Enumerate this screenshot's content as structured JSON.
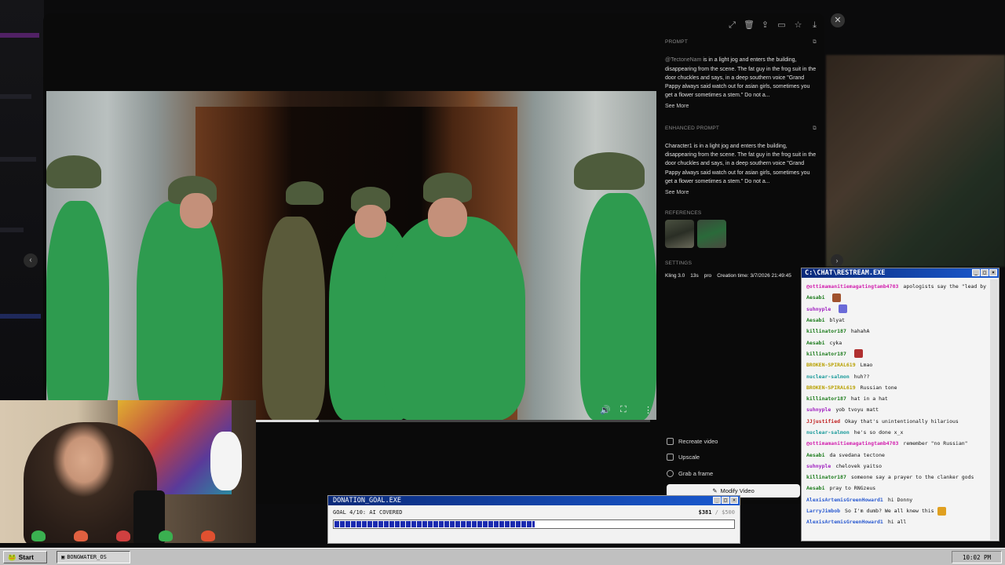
{
  "modal": {
    "toolbar_icons": [
      "expand-icon",
      "trash-icon",
      "share-icon",
      "folder-icon",
      "star-icon",
      "download-icon"
    ],
    "close_glyph": "✕",
    "prev_glyph": "‹",
    "next_glyph": "›",
    "video": {
      "progress": 0.16,
      "controls": [
        "volume-icon",
        "fullscreen-icon",
        "more-icon"
      ]
    },
    "prompt": {
      "heading": "PROMPT",
      "mention": "@TectoneNam",
      "text": " is in a light jog and enters the building, disappearing from the scene. The fat guy in the frog suit in the door chuckles and says, in a deep southern voice \"Grand Pappy always said watch out for asian girls, sometimes you get a flower sometimes a stem.\" Do not a...",
      "see_more": "See More"
    },
    "enhanced_prompt": {
      "heading": "ENHANCED PROMPT",
      "text": "Character1 is in a light jog and enters the building, disappearing from the scene. The fat guy in the frog suit in the door chuckles and says, in a deep southern voice \"Grand Pappy always said watch out for asian girls, sometimes you get a flower sometimes a stem.\" Do not a...",
      "see_more": "See More"
    },
    "references": {
      "heading": "REFERENCES"
    },
    "settings": {
      "heading": "SETTINGS",
      "model": "Kling 3.0",
      "duration": "13s",
      "tier": "pro",
      "creation": "Creation time: 3/7/2026 21:49:45"
    },
    "actions": {
      "recreate": "Recreate video",
      "upscale": "Upscale",
      "grab": "Grab a frame",
      "modify": "Modify Video"
    }
  },
  "chat": {
    "title": "C:\\CHAT\\RESTREAM.EXE",
    "messages": [
      {
        "user": "@ottimamanitiemagatingtamb4703",
        "color": "#d21fae",
        "text": "apologists say the \"lead by a pig story\" to dumb people"
      },
      {
        "user": "Aesabi",
        "color": "#1a7a1a",
        "text": "",
        "emote": "#a0522d"
      },
      {
        "user": "suhnyple",
        "color": "#a020c0",
        "text": "",
        "emote": "#6a6ad8"
      },
      {
        "user": "Aesabi",
        "color": "#1a7a1a",
        "text": "blyat"
      },
      {
        "user": "killinator187",
        "color": "#1a7a1a",
        "text": "hahahA"
      },
      {
        "user": "Aesabi",
        "color": "#1a7a1a",
        "text": "cyka"
      },
      {
        "user": "killinator187",
        "color": "#1a7a1a",
        "text": "",
        "emote": "#b03030"
      },
      {
        "user": "BROKEN-SPIRAL619",
        "color": "#b8a000",
        "text": "Lmao"
      },
      {
        "user": "nuclear-salmon",
        "color": "#1a9a9a",
        "text": "huh??"
      },
      {
        "user": "BROKEN-SPIRAL619",
        "color": "#b8a000",
        "text": "Russian tone"
      },
      {
        "user": "killinator187",
        "color": "#1a7a1a",
        "text": "hat in a hat"
      },
      {
        "user": "suhnyple",
        "color": "#a020c0",
        "text": "yob tvoyu matt"
      },
      {
        "user": "JJjustified",
        "color": "#c02020",
        "text": "Okay that's unintentionally hilarious"
      },
      {
        "user": "nuclear-salmon",
        "color": "#1a9a9a",
        "text": "he's so done x_x"
      },
      {
        "user": "@ottimamanitiemagatingtamb4703",
        "color": "#d21fae",
        "text": "remember \"no Russian\""
      },
      {
        "user": "Aesabi",
        "color": "#1a7a1a",
        "text": "da svedana tectone"
      },
      {
        "user": "suhnyple",
        "color": "#a020c0",
        "text": "chelovek yaitso"
      },
      {
        "user": "killinator187",
        "color": "#1a7a1a",
        "text": "someone say a prayer to the clanker gods"
      },
      {
        "user": "Aesabi",
        "color": "#1a7a1a",
        "text": "pray to RNGzeus"
      },
      {
        "user": "AlexisArtemisGreenHoward1",
        "color": "#2a5ad0",
        "text": "hi Donny"
      },
      {
        "user": "LarryJimbob",
        "color": "#2a5ad0",
        "text": "So I'm dumb? We all knew this",
        "emote": "#e0a020"
      },
      {
        "user": "AlexisArtemisGreenHoward1",
        "color": "#2a5ad0",
        "text": "hi all"
      }
    ]
  },
  "donation": {
    "title": "DONATION_GOAL.EXE",
    "goal": "GOAL 4/10: AI COVERED",
    "current": "$381",
    "target": " / $500",
    "progress": 0.5
  },
  "taskbar": {
    "start": "Start",
    "task": "BONGWATER_OS",
    "clock": "10:02 PM"
  },
  "colors": {
    "title_bar_start": "#0a2a7a",
    "title_bar_end": "#1a5ad0",
    "frog_green": "#2e9b4f"
  }
}
